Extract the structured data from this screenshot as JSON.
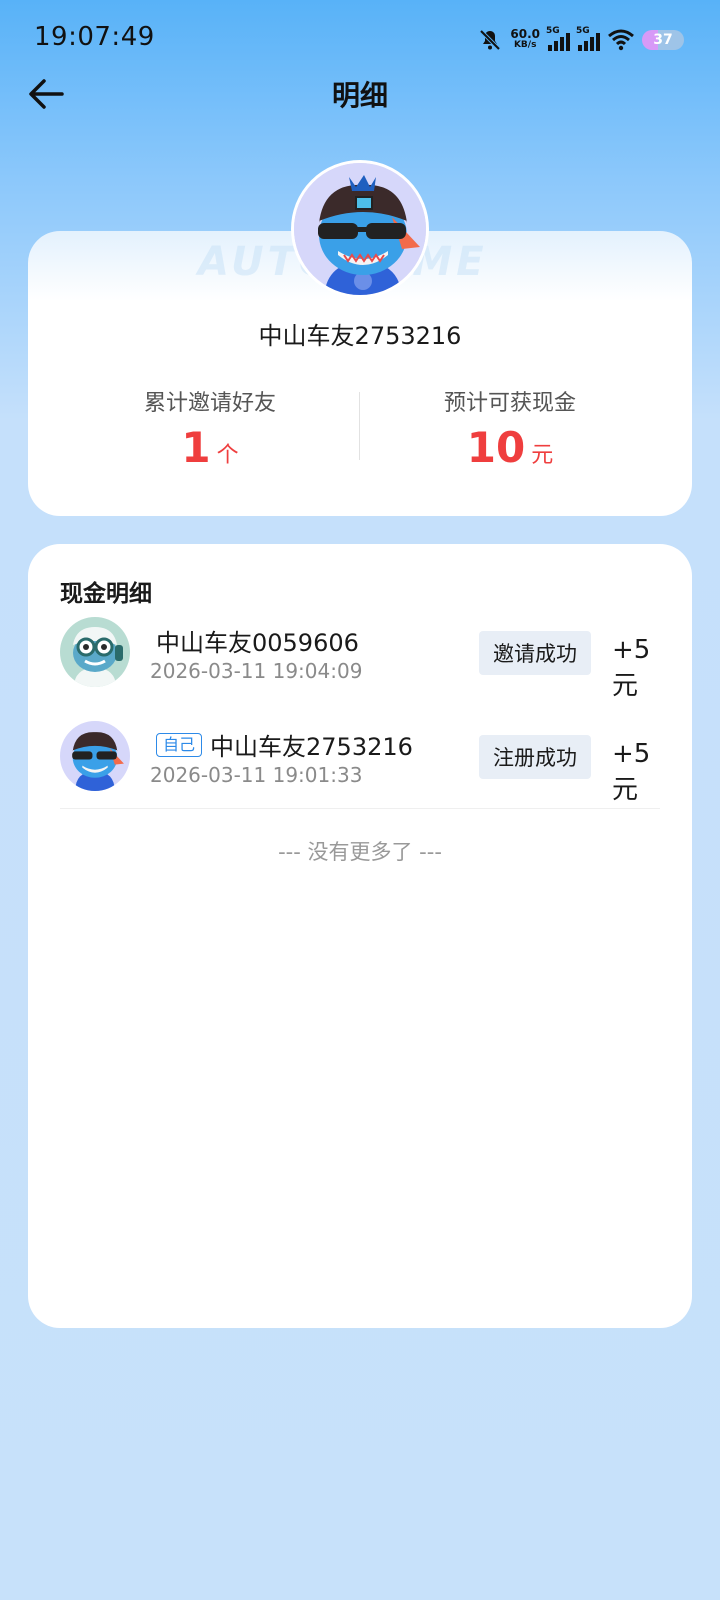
{
  "status_bar": {
    "time": "19:07:49",
    "net_speed_value": "60.0",
    "net_speed_unit": "KB/s",
    "sim1_label": "5G",
    "sim2_label": "5G",
    "battery": "37"
  },
  "header": {
    "title": "明细",
    "back_icon": "arrow-left-icon"
  },
  "profile": {
    "watermark": "AUTOHOME",
    "username": "中山车友2753216",
    "invited_label": "累计邀请好友",
    "invited_value": "1",
    "invited_unit": "个",
    "cash_label": "预计可获现金",
    "cash_value": "10",
    "cash_unit": "元"
  },
  "details": {
    "title": "现金明细",
    "rows": [
      {
        "name": "中山车友0059606",
        "tag": "",
        "time": "2026-03-11 19:04:09",
        "status": "邀请成功",
        "amount": "+5元"
      },
      {
        "name": "中山车友2753216",
        "tag": "自己",
        "time": "2026-03-11 19:01:33",
        "status": "注册成功",
        "amount": "+5元"
      }
    ],
    "no_more": "--- 没有更多了 ---"
  },
  "colors": {
    "accent_red": "#ef3e3e",
    "tag_blue": "#2d8ae8",
    "background_blue": "#c7e1fa"
  }
}
